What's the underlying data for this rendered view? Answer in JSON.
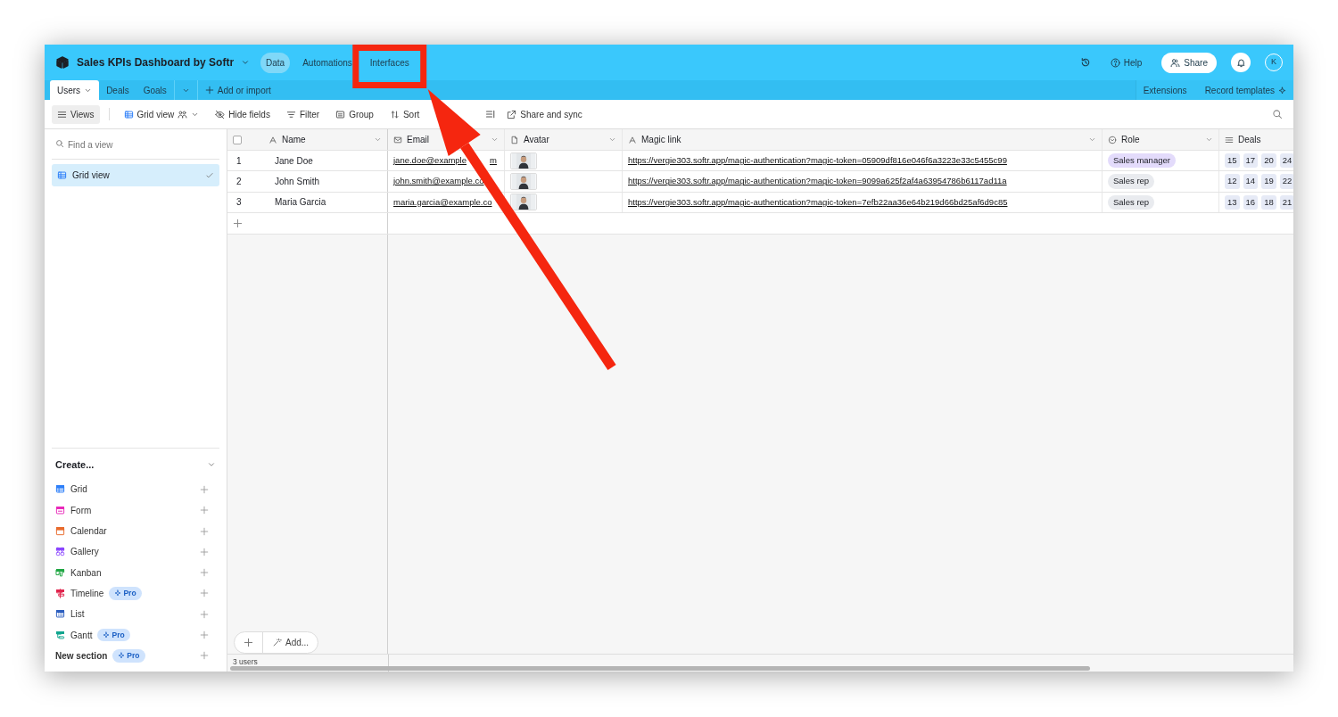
{
  "app": {
    "title": "Sales KPIs Dashboard by Softr",
    "nav": [
      {
        "label": "Data",
        "selected": true,
        "highlighted": false
      },
      {
        "label": "Automations",
        "selected": false,
        "highlighted": false
      },
      {
        "label": "Interfaces",
        "selected": false,
        "highlighted": true
      }
    ],
    "help": "Help",
    "share": "Share",
    "avatar": "K"
  },
  "tables": {
    "tabs": [
      {
        "label": "Users",
        "selected": true
      },
      {
        "label": "Deals",
        "selected": false
      },
      {
        "label": "Goals",
        "selected": false
      }
    ],
    "add": "Add or import",
    "right": [
      "Extensions",
      "Record templates"
    ]
  },
  "toolbar": {
    "views": "Views",
    "view_name": "Grid view",
    "tools": [
      {
        "kind": "hide",
        "label": "Hide fields"
      },
      {
        "kind": "filter",
        "label": "Filter"
      },
      {
        "kind": "group",
        "label": "Group"
      },
      {
        "kind": "sort",
        "label": "Sort"
      }
    ],
    "share_sync": "Share and sync"
  },
  "sidebar": {
    "search": {
      "placeholder": "Find a view"
    },
    "views": [
      {
        "label": "Grid view",
        "selected": true
      }
    ],
    "create_title": "Create...",
    "create": [
      {
        "kind": "grid",
        "label": "Grid",
        "color": "#2d7ff9"
      },
      {
        "kind": "form",
        "label": "Form",
        "color": "#e929ba"
      },
      {
        "kind": "calendar",
        "label": "Calendar",
        "color": "#e86a2c"
      },
      {
        "kind": "gallery",
        "label": "Gallery",
        "color": "#8b46ff"
      },
      {
        "kind": "kanban",
        "label": "Kanban",
        "color": "#20a744"
      },
      {
        "kind": "timeline",
        "label": "Timeline",
        "color": "#e0244c",
        "badge": "Pro"
      },
      {
        "kind": "list",
        "label": "List",
        "color": "#2d5fbf"
      },
      {
        "kind": "gantt",
        "label": "Gantt",
        "color": "#11a58f",
        "badge": "Pro"
      },
      {
        "kind": "section",
        "label": "New section",
        "badge": "Pro"
      }
    ]
  },
  "grid": {
    "columns": [
      {
        "kind": "text",
        "label": "Name"
      },
      {
        "kind": "email",
        "label": "Email"
      },
      {
        "kind": "attachment",
        "label": "Avatar"
      },
      {
        "kind": "text",
        "label": "Magic link"
      },
      {
        "kind": "select",
        "label": "Role"
      },
      {
        "kind": "link",
        "label": "Deals"
      }
    ],
    "rows": [
      {
        "number": "1",
        "name": "Jane Doe",
        "email": "jane.doe@example",
        "email_end": "m",
        "magic_link": "https://vergie303.softr.app/magic-authentication?magic-token=05909df816e046f6a3223e33c5455c99",
        "role": {
          "label": "Sales manager",
          "color": "#e3dbfb"
        },
        "deals": [
          "15",
          "17",
          "20",
          "24"
        ]
      },
      {
        "number": "2",
        "name": "John Smith",
        "email": "john.smith@example.co",
        "magic_link": "https://vergie303.softr.app/magic-authentication?magic-token=9099a625f2af4a63954786b6117ad11a",
        "role": {
          "label": "Sales rep",
          "color": "#e9ebef"
        },
        "deals": [
          "12",
          "14",
          "19",
          "22"
        ]
      },
      {
        "number": "3",
        "name": "Maria Garcia",
        "email": "maria.garcia@example.co",
        "magic_link": "https://vergie303.softr.app/magic-authentication?magic-token=7efb22aa36e64b219d66bd25af6d9c85",
        "role": {
          "label": "Sales rep",
          "color": "#e9ebef"
        },
        "deals": [
          "13",
          "16",
          "18",
          "21"
        ]
      }
    ],
    "all_checked": false,
    "add_button": "Add...",
    "record_count": "3 users"
  },
  "arrow": true
}
